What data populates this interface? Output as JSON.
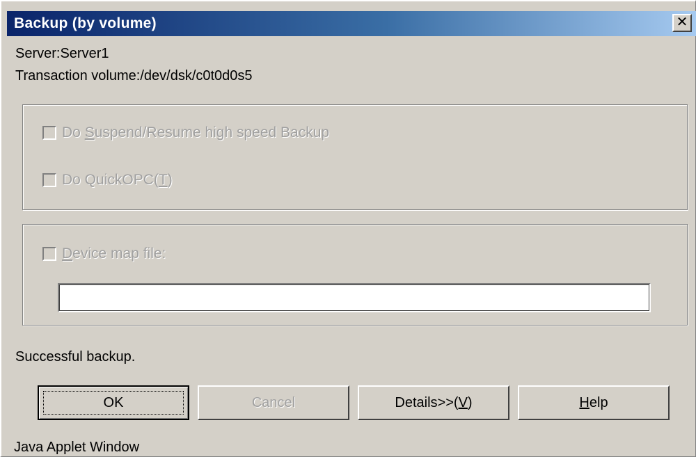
{
  "window": {
    "title": "Backup (by volume)",
    "close_glyph": "✕"
  },
  "info": {
    "server": "Server:Server1",
    "transaction_volume": "Transaction volume:/dev/dsk/c0t0d0s5"
  },
  "options": {
    "suspend_resume": {
      "pre": "Do ",
      "mnemonic": "S",
      "post": "uspend/Resume high speed Backup",
      "checked": false,
      "enabled": false
    },
    "quickopc": {
      "pre": "Do QuickOPC(",
      "mnemonic": "T",
      "post": ")",
      "checked": false,
      "enabled": false
    }
  },
  "device_map": {
    "mnemonic": "D",
    "post": "evice map file:",
    "checked": false,
    "enabled": false,
    "value": ""
  },
  "status_message": "Successful backup.",
  "buttons": {
    "ok": "OK",
    "cancel": "Cancel",
    "details_pre": "Details>>(",
    "details_mnemonic": "V",
    "details_post": ")",
    "help_mnemonic": "H",
    "help_post": "elp"
  },
  "footer": "Java Applet Window",
  "colors": {
    "titlebar_start": "#0a246a",
    "titlebar_end": "#a6caf0",
    "dialog_bg": "#d4d0c8",
    "disabled_text": "#a0a0a0"
  }
}
